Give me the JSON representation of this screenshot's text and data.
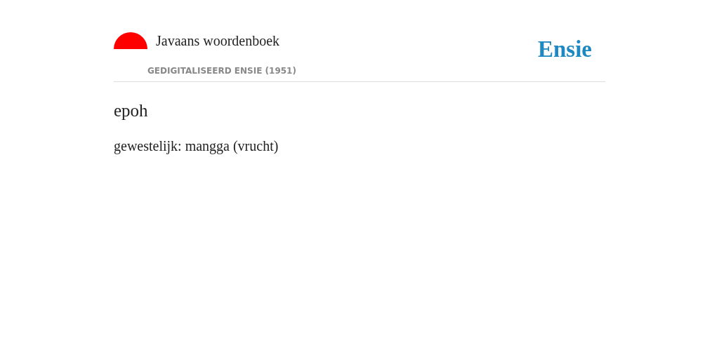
{
  "header": {
    "title": "Javaans woordenboek",
    "subtitle": "GEDIGITALISEERD ENSIE (1951)",
    "brand": "Ensie"
  },
  "entry": {
    "word": "epoh",
    "definition": "gewestelijk: mangga (vrucht)"
  }
}
